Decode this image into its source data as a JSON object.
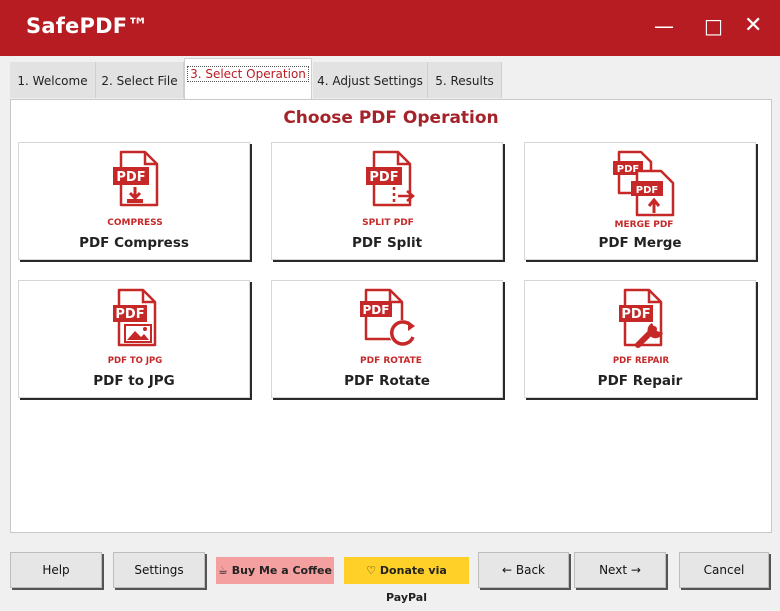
{
  "window": {
    "title": "SafePDF™",
    "minimize_glyph": "—",
    "maximize_glyph": "□",
    "close_glyph": "✕"
  },
  "tabs": [
    {
      "label": "1. Welcome",
      "active": false
    },
    {
      "label": "2. Select File",
      "active": false
    },
    {
      "label": "3. Select Operation",
      "active": true
    },
    {
      "label": "4. Adjust Settings",
      "active": false
    },
    {
      "label": "5. Results",
      "active": false
    }
  ],
  "main": {
    "heading": "Choose PDF Operation",
    "operations": [
      {
        "label": "PDF Compress",
        "icon": "pdf-compress-icon",
        "icon_caption": "COMPRESS",
        "icon_badge": "PDF"
      },
      {
        "label": "PDF Split",
        "icon": "pdf-split-icon",
        "icon_caption": "SPLIT PDF",
        "icon_badge": "PDF"
      },
      {
        "label": "PDF Merge",
        "icon": "pdf-merge-icon",
        "icon_caption": "MERGE PDF",
        "icon_badge": "PDF"
      },
      {
        "label": "PDF to JPG",
        "icon": "pdf-to-jpg-icon",
        "icon_caption": "PDF TO JPG",
        "icon_badge": "PDF"
      },
      {
        "label": "PDF Rotate",
        "icon": "pdf-rotate-icon",
        "icon_caption": "PDF ROTATE",
        "icon_badge": "PDF"
      },
      {
        "label": "PDF Repair",
        "icon": "pdf-repair-icon",
        "icon_caption": "PDF REPAIR",
        "icon_badge": "PDF"
      }
    ]
  },
  "footer": {
    "help": "Help",
    "settings": "Settings",
    "coffee": "Buy Me a Coffee",
    "paypal": "Donate via PayPal",
    "back": "← Back",
    "next": "Next →",
    "cancel": "Cancel"
  },
  "colors": {
    "brand": "#b81c23",
    "heading": "#a4232a",
    "coffee_bg": "#f4a0a0",
    "paypal_bg": "#ffd028"
  }
}
